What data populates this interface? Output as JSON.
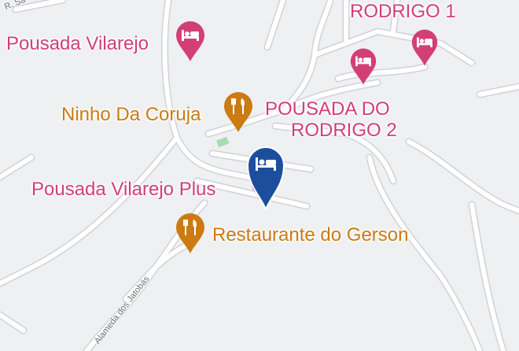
{
  "map": {
    "colors": {
      "background": "#eef0f1",
      "road": "#ffffff",
      "road_edge": "#cfd3d7",
      "park": "#a8dab5",
      "hotel": "#d23f75",
      "restaurant": "#cc7a12",
      "selected_pin": "#1d4e9e"
    }
  },
  "places": {
    "pousada_vilarejo": {
      "name": "Pousada Vilarejo",
      "type": "hotel",
      "icon": "bed-icon"
    },
    "ninho_da_coruja": {
      "name": "Ninho Da Coruja",
      "type": "restaurant",
      "icon": "fork-knife-icon"
    },
    "pousada_do_rodrigo_2": {
      "line1": "POUSADA DO",
      "line2": "RODRIGO 2",
      "type": "hotel",
      "icon": "bed-icon"
    },
    "rodrigo_1": {
      "name": "RODRIGO 1",
      "type": "hotel",
      "icon": "bed-icon"
    },
    "pousada_vilarejo_plus": {
      "name": "Pousada Vilarejo Plus",
      "type": "hotel",
      "icon": "bed-icon",
      "selected": true
    },
    "restaurante_do_gerson": {
      "name": "Restaurante do Gerson",
      "type": "restaurant",
      "icon": "fork-knife-icon"
    }
  },
  "streets": {
    "alameda_dos_jatobas": "Alameda dos Jatobás",
    "top_left_street": "R. Sa"
  }
}
